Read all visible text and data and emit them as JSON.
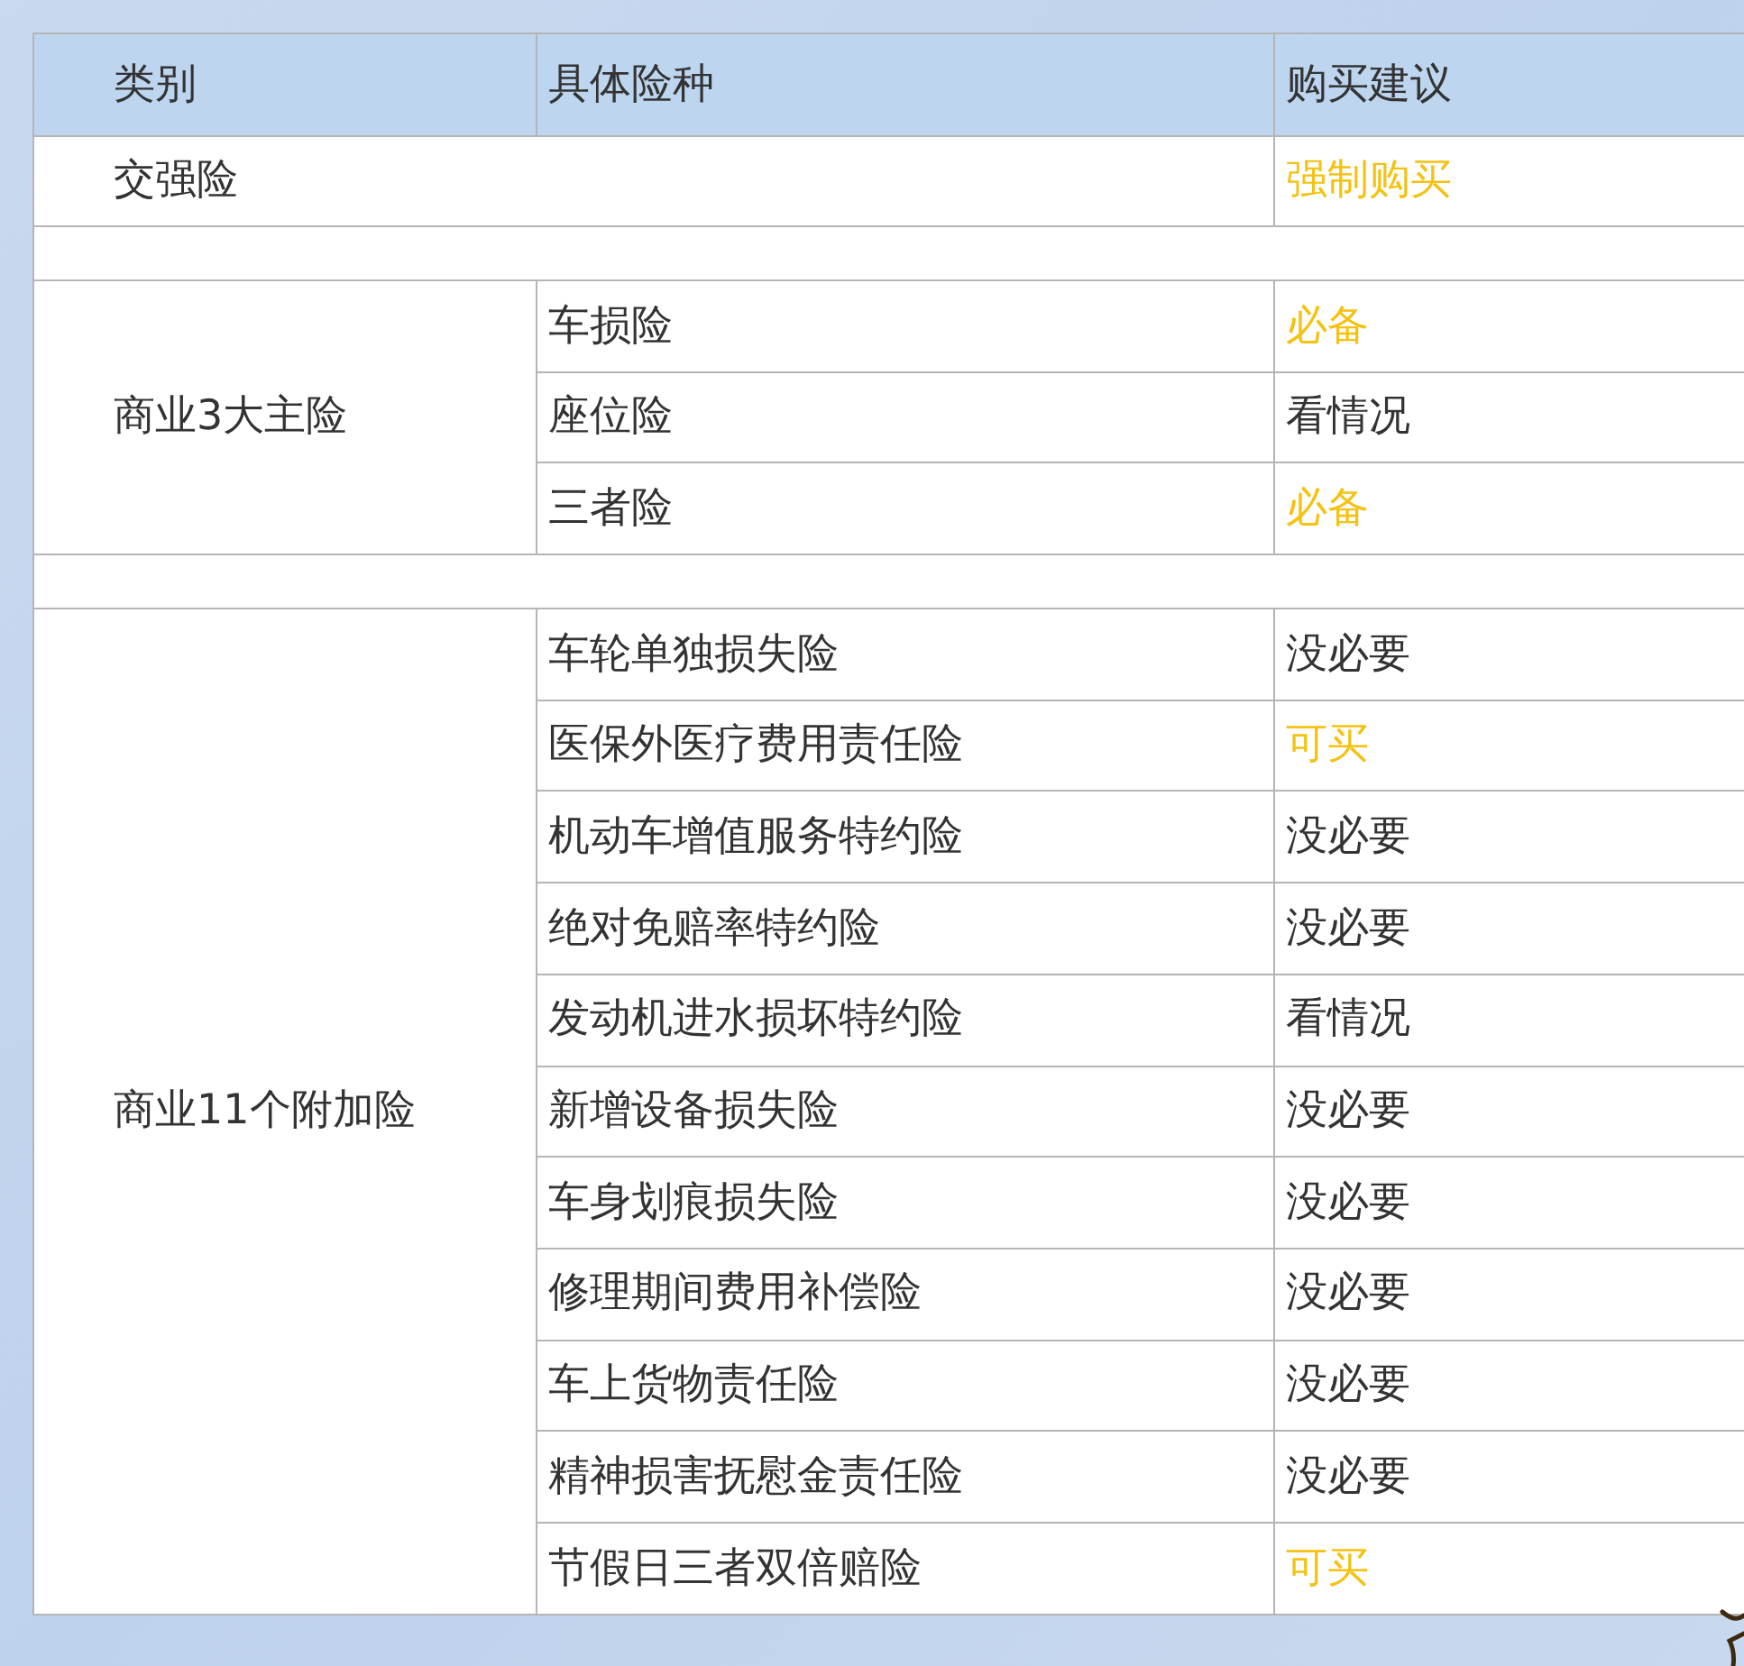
{
  "table": {
    "columns": [
      "类别",
      "具体险种",
      "购买建议"
    ],
    "groups": [
      {
        "kind": "single",
        "category": "交强险",
        "advice": "强制购买",
        "highlighted": true
      },
      {
        "kind": "spacer"
      },
      {
        "kind": "group",
        "category": "商业3大主险",
        "items": [
          {
            "name": "车损险",
            "advice": "必备",
            "highlighted": true
          },
          {
            "name": "座位险",
            "advice": "看情况",
            "highlighted": false
          },
          {
            "name": "三者险",
            "advice": "必备",
            "highlighted": true
          }
        ]
      },
      {
        "kind": "spacer"
      },
      {
        "kind": "group",
        "category": "商业11个附加险",
        "items": [
          {
            "name": "车轮单独损失险",
            "advice": "没必要",
            "highlighted": false
          },
          {
            "name": "医保外医疗费用责任险",
            "advice": "可买",
            "highlighted": true
          },
          {
            "name": "机动车增值服务特约险",
            "advice": "没必要",
            "highlighted": false
          },
          {
            "name": "绝对免赔率特约险",
            "advice": "没必要",
            "highlighted": false
          },
          {
            "name": "发动机进水损坏特约险",
            "advice": "看情况",
            "highlighted": false
          },
          {
            "name": "新增设备损失险",
            "advice": "没必要",
            "highlighted": false
          },
          {
            "name": "车身划痕损失险",
            "advice": "没必要",
            "highlighted": false
          },
          {
            "name": "修理期间费用补偿险",
            "advice": "没必要",
            "highlighted": false
          },
          {
            "name": "车上货物责任险",
            "advice": "没必要",
            "highlighted": false
          },
          {
            "name": "精神损害抚慰金责任险",
            "advice": "没必要",
            "highlighted": false
          },
          {
            "name": "节假日三者双倍赔险",
            "advice": "可买",
            "highlighted": true
          }
        ]
      }
    ]
  }
}
